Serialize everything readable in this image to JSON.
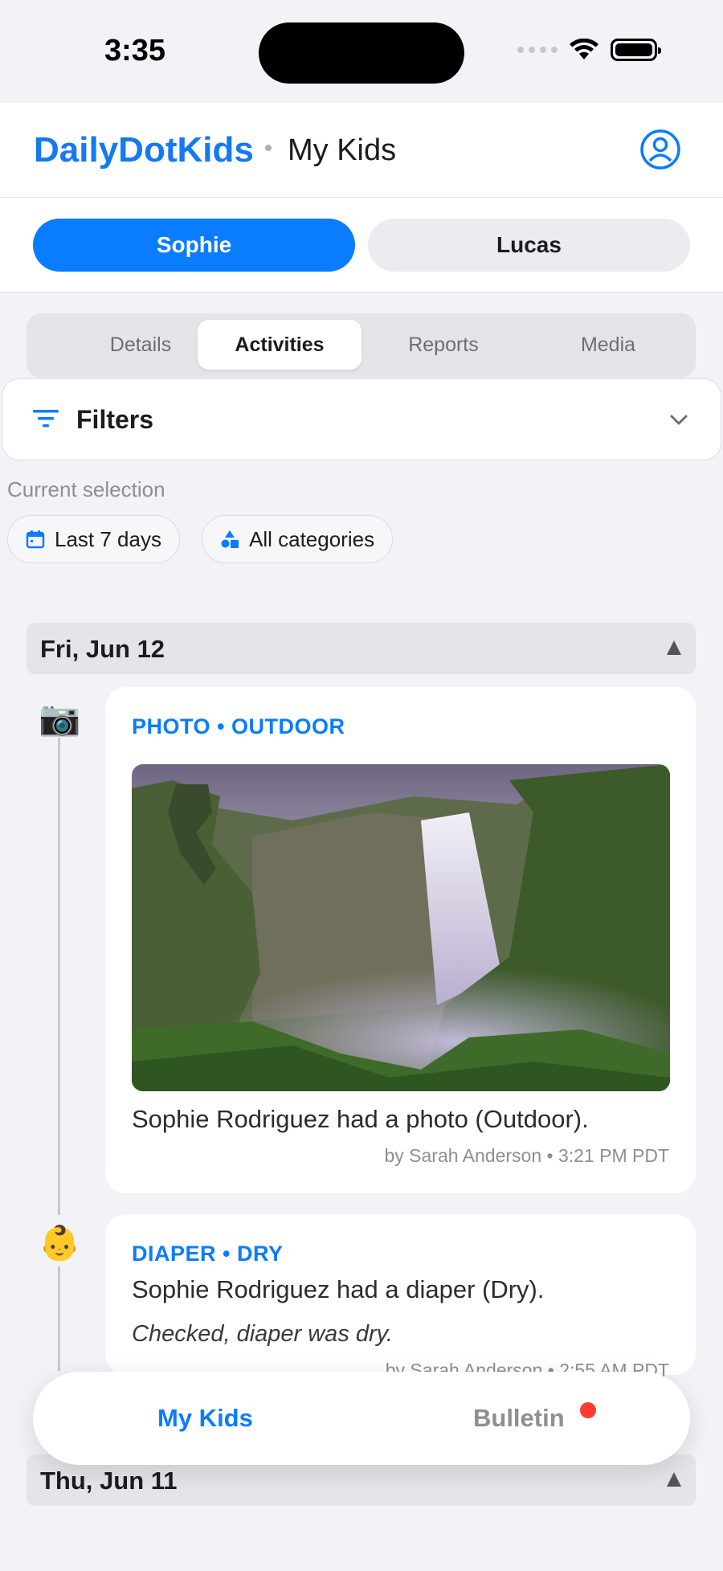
{
  "status_bar": {
    "time": "3:35"
  },
  "header": {
    "brand": "DailyDotKids",
    "subtitle": "My Kids"
  },
  "kids": [
    {
      "name": "Sophie",
      "selected": true
    },
    {
      "name": "Lucas",
      "selected": false
    }
  ],
  "tabs": [
    {
      "label": "Details",
      "selected": false
    },
    {
      "label": "Activities",
      "selected": true
    },
    {
      "label": "Reports",
      "selected": false
    },
    {
      "label": "Media",
      "selected": false
    }
  ],
  "filters": {
    "label": "Filters",
    "current_selection_label": "Current selection",
    "chips": [
      {
        "label": "Last 7 days",
        "icon": "calendar-icon"
      },
      {
        "label": "All categories",
        "icon": "shapes-icon"
      }
    ]
  },
  "days": [
    {
      "date": "Fri, Jun 12",
      "entries": [
        {
          "icon": "📷",
          "category": "PHOTO • OUTDOOR",
          "description": "Sophie Rodriguez had a photo (Outdoor).",
          "meta": "by Sarah Anderson • 3:21 PM PDT"
        },
        {
          "icon": "👶",
          "category": "DIAPER • DRY",
          "description": "Sophie Rodriguez had a diaper (Dry).",
          "note": "Checked, diaper was dry.",
          "meta": "by Sarah Anderson • 2:55 AM PDT"
        }
      ]
    },
    {
      "date": "Thu, Jun 11"
    }
  ],
  "tabbar": {
    "my_kids": "My Kids",
    "bulletin": "Bulletin"
  },
  "colors": {
    "accent": "#0a7cff",
    "badge": "#ff3b30",
    "background": "#f2f2f7"
  }
}
